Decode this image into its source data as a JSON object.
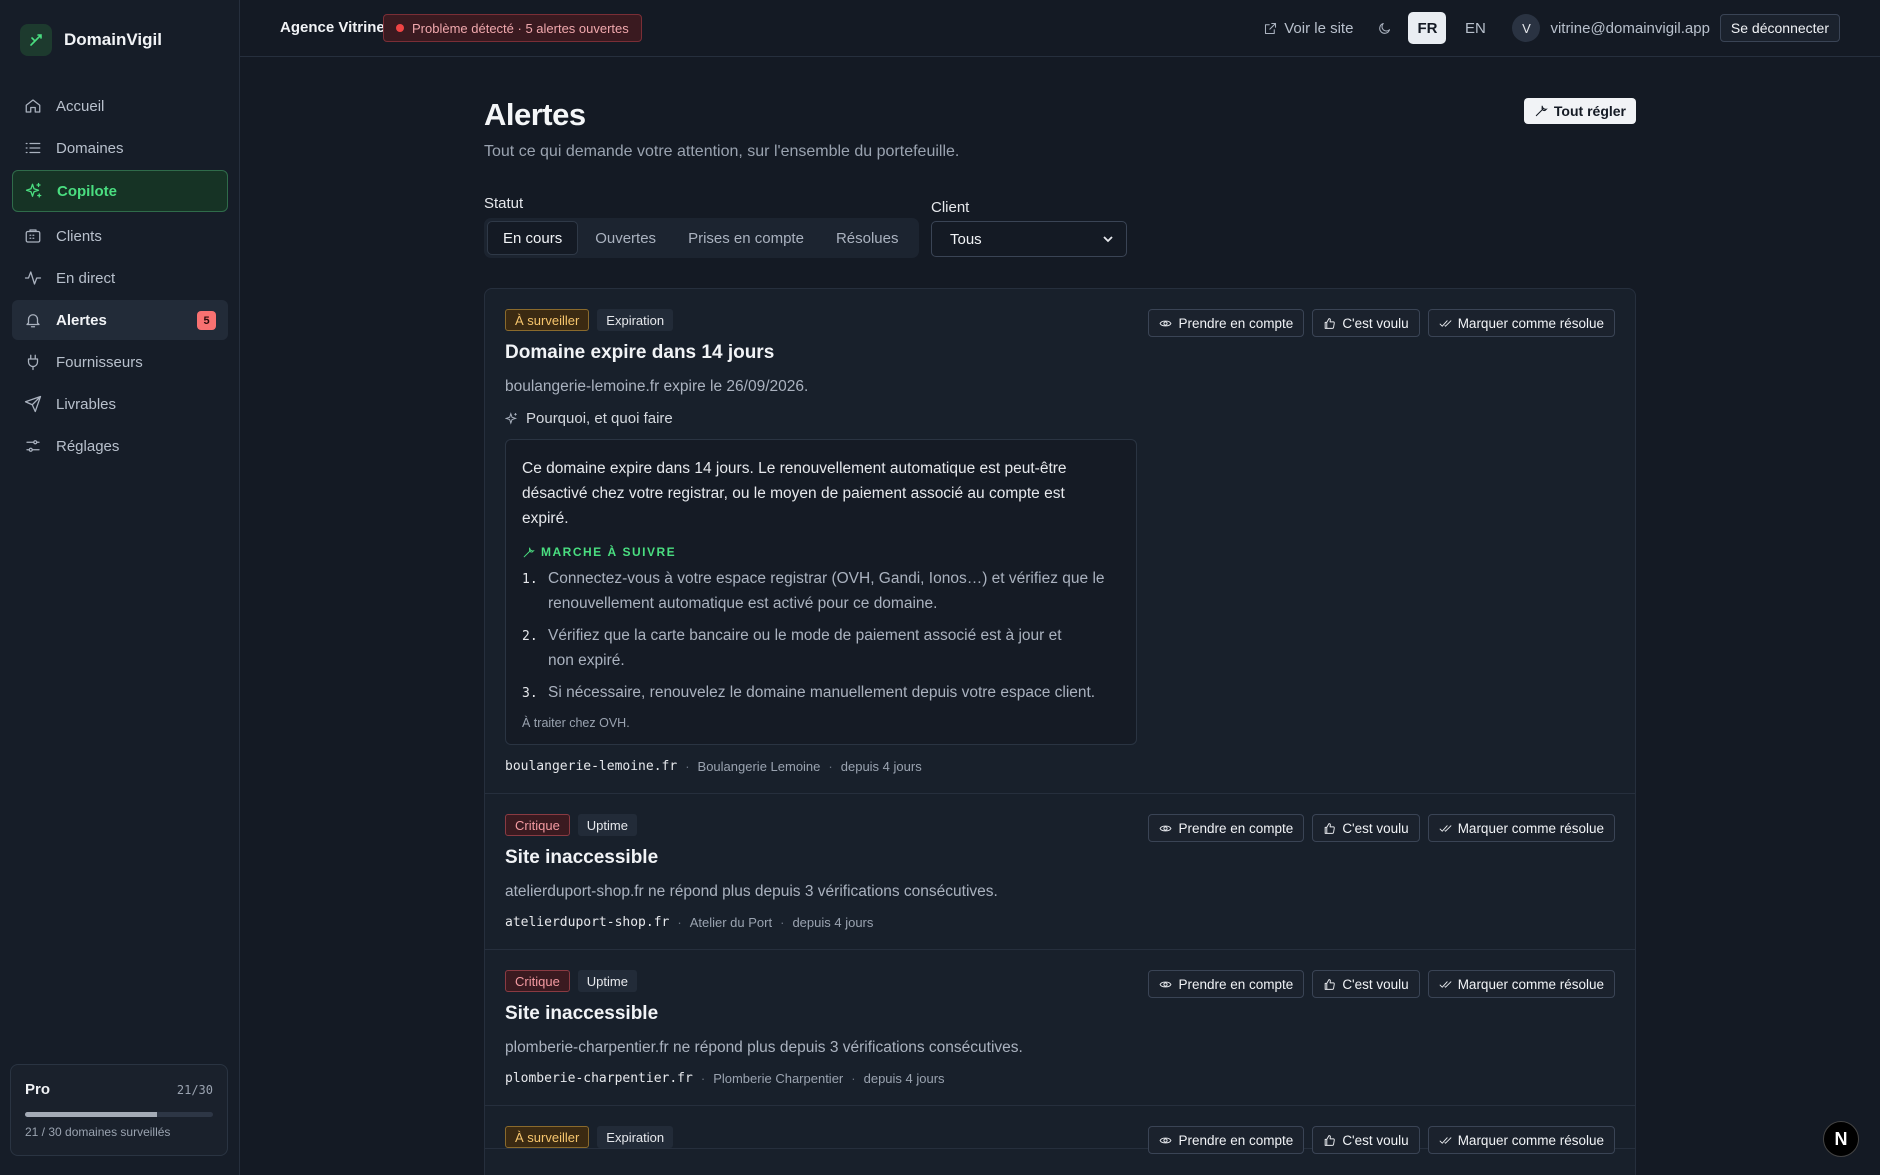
{
  "brand": {
    "name": "DomainVigil"
  },
  "sidebar": {
    "items": [
      {
        "label": "Accueil"
      },
      {
        "label": "Domaines"
      },
      {
        "label": "Copilote"
      },
      {
        "label": "Clients"
      },
      {
        "label": "En direct"
      },
      {
        "label": "Alertes",
        "badge": "5"
      },
      {
        "label": "Fournisseurs"
      },
      {
        "label": "Livrables"
      },
      {
        "label": "Réglages"
      }
    ],
    "plan": {
      "name": "Pro",
      "count": "21/30",
      "text": "21 / 30 domaines surveillés",
      "progress": 0.7
    }
  },
  "topbar": {
    "org": "Agence Vitrine",
    "status": "Problème détecté · 5 alertes ouvertes",
    "view_site": "Voir le site",
    "lang_fr": "FR",
    "lang_en": "EN",
    "avatar": "V",
    "email": "vitrine@domainvigil.app",
    "logout": "Se déconnecter"
  },
  "page": {
    "title": "Alertes",
    "subtitle": "Tout ce qui demande votre attention, sur l'ensemble du portefeuille.",
    "fix_all": "Tout régler",
    "status_label": "Statut",
    "tabs": [
      "En cours",
      "Ouvertes",
      "Prises en compte",
      "Résolues"
    ],
    "client_label": "Client",
    "client_value": "Tous"
  },
  "actions": {
    "ack": "Prendre en compte",
    "intended": "C'est voulu",
    "resolve": "Marquer comme résolue"
  },
  "alerts": [
    {
      "severity": "À surveiller",
      "type": "Expiration",
      "title": "Domaine expire dans 14 jours",
      "desc": "boulangerie-lemoine.fr expire le 26/09/2026.",
      "why": "Pourquoi, et quoi faire",
      "explain": "Ce domaine expire dans 14 jours. Le renouvellement automatique est peut-être désactivé chez votre registrar, ou le moyen de paiement associé au compte est expiré.",
      "steps_head": "MARCHE À SUIVRE",
      "steps": [
        "Connectez-vous à votre espace registrar (OVH, Gandi, Ionos…) et vérifiez que le renouvellement automatique est activé pour ce domaine.",
        "Vérifiez que la carte bancaire ou le mode de paiement associé est à jour et non expiré.",
        "Si nécessaire, renouvelez le domaine manuellement depuis votre espace client."
      ],
      "note": "À traiter chez OVH.",
      "domain": "boulangerie-lemoine.fr",
      "client": "Boulangerie Lemoine",
      "since": "depuis 4 jours"
    },
    {
      "severity": "Critique",
      "type": "Uptime",
      "title": "Site inaccessible",
      "desc": "atelierduport-shop.fr ne répond plus depuis 3 vérifications consécutives.",
      "domain": "atelierduport-shop.fr",
      "client": "Atelier du Port",
      "since": "depuis 4 jours"
    },
    {
      "severity": "Critique",
      "type": "Uptime",
      "title": "Site inaccessible",
      "desc": "plomberie-charpentier.fr ne répond plus depuis 3 vérifications consécutives.",
      "domain": "plomberie-charpentier.fr",
      "client": "Plomberie Charpentier",
      "since": "depuis 4 jours"
    },
    {
      "severity": "À surveiller",
      "type": "Expiration"
    }
  ],
  "fab": "N"
}
